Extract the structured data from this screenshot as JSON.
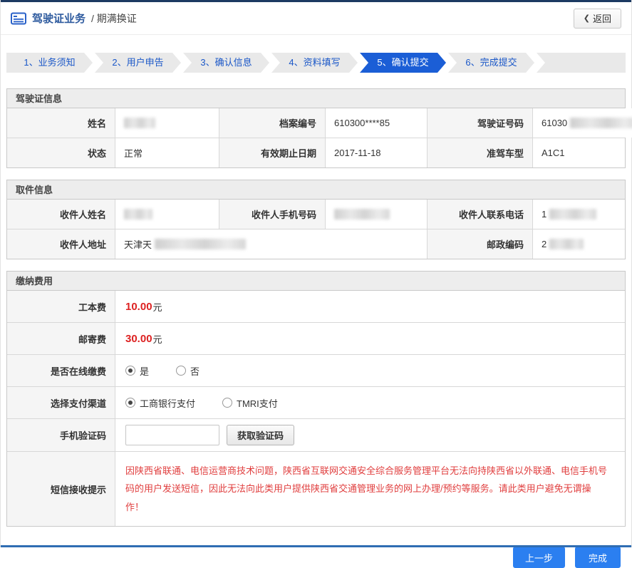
{
  "header": {
    "title": "驾驶证业务",
    "subtitle": "/ 期满换证",
    "back_icon": "❮",
    "back_label": "返回"
  },
  "steps": [
    {
      "label": "1、业务须知",
      "active": false
    },
    {
      "label": "2、用户申告",
      "active": false
    },
    {
      "label": "3、确认信息",
      "active": false
    },
    {
      "label": "4、资料填写",
      "active": false
    },
    {
      "label": "5、确认提交",
      "active": true
    },
    {
      "label": "6、完成提交",
      "active": false
    }
  ],
  "license": {
    "title": "驾驶证信息",
    "name_label": "姓名",
    "file_no_label": "档案编号",
    "file_no_value": "610300****85",
    "license_no_label": "驾驶证号码",
    "license_no_prefix": "61030",
    "status_label": "状态",
    "status_value": "正常",
    "expiry_label": "有效期止日期",
    "expiry_value": "2017-11-18",
    "vehicle_label": "准驾车型",
    "vehicle_value": "A1C1"
  },
  "pickup": {
    "title": "取件信息",
    "recipient_name_label": "收件人姓名",
    "mobile_label": "收件人手机号码",
    "phone_label": "收件人联系电话",
    "phone_prefix": "1",
    "address_label": "收件人地址",
    "address_prefix": "天津天",
    "postcode_label": "邮政编码",
    "postcode_prefix": "2"
  },
  "payment": {
    "title": "缴纳费用",
    "fee1_label": "工本费",
    "fee1_value": "10.00",
    "fee1_unit": "元",
    "fee2_label": "邮寄费",
    "fee2_value": "30.00",
    "fee2_unit": "元",
    "online_label": "是否在线缴费",
    "online_options": [
      {
        "label": "是",
        "checked": true
      },
      {
        "label": "否",
        "checked": false
      }
    ],
    "channel_label": "选择支付渠道",
    "channel_options": [
      {
        "label": "工商银行支付",
        "checked": true
      },
      {
        "label": "TMRI支付",
        "checked": false
      }
    ],
    "captcha_label": "手机验证码",
    "captcha_value": "",
    "get_code_label": "获取验证码",
    "notice_label": "短信接收提示",
    "notice_text": "因陕西省联通、电信运营商技术问题，陕西省互联网交通安全综合服务管理平台无法向持陕西省以外联通、电信手机号码的用户发送短信，因此无法向此类用户提供陕西省交通管理业务的网上办理/预约等服务。请此类用户避免无谓操作！"
  },
  "footer": {
    "prev_label": "上一步",
    "done_label": "完成"
  },
  "colors": {
    "accent_blue": "#1b5ed6",
    "step_text_blue": "#1a57c8",
    "fee_red": "#dd2222",
    "notice_red": "#e03e3e"
  }
}
